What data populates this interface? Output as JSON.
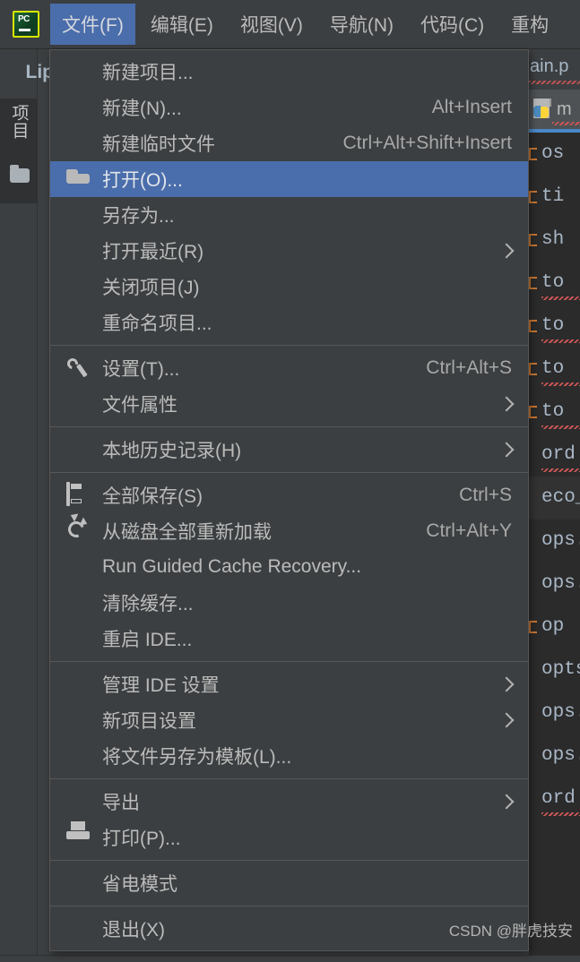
{
  "app": {
    "logo_text": "PC",
    "panel_label": "Lip"
  },
  "menubar": {
    "items": [
      {
        "label": "文件(F)",
        "mnemonic": "F",
        "active": true
      },
      {
        "label": "编辑(E)",
        "mnemonic": "E",
        "active": false
      },
      {
        "label": "视图(V)",
        "mnemonic": "V",
        "active": false
      },
      {
        "label": "导航(N)",
        "mnemonic": "N",
        "active": false
      },
      {
        "label": "代码(C)",
        "mnemonic": "C",
        "active": false
      },
      {
        "label": "重构",
        "mnemonic": "",
        "active": false
      }
    ]
  },
  "sidebar": {
    "project_tab_label": "项目",
    "folder_icon": "folder-icon"
  },
  "file_menu": {
    "groups": [
      {
        "items": [
          {
            "label": "新建项目...",
            "accel": "",
            "icon": "",
            "arrow": false,
            "selected": false
          },
          {
            "label": "新建(N)...",
            "accel": "Alt+Insert",
            "icon": "",
            "arrow": false,
            "selected": false
          },
          {
            "label": "新建临时文件",
            "accel": "Ctrl+Alt+Shift+Insert",
            "icon": "",
            "arrow": false,
            "selected": false
          },
          {
            "label": "打开(O)...",
            "accel": "",
            "icon": "folder-open-icon",
            "arrow": false,
            "selected": true
          },
          {
            "label": "另存为...",
            "accel": "",
            "icon": "",
            "arrow": false,
            "selected": false
          },
          {
            "label": "打开最近(R)",
            "accel": "",
            "icon": "",
            "arrow": true,
            "selected": false
          },
          {
            "label": "关闭项目(J)",
            "accel": "",
            "icon": "",
            "arrow": false,
            "selected": false
          },
          {
            "label": "重命名项目...",
            "accel": "",
            "icon": "",
            "arrow": false,
            "selected": false
          }
        ]
      },
      {
        "items": [
          {
            "label": "设置(T)...",
            "accel": "Ctrl+Alt+S",
            "icon": "wrench-icon",
            "arrow": false,
            "selected": false
          },
          {
            "label": "文件属性",
            "accel": "",
            "icon": "",
            "arrow": true,
            "selected": false
          }
        ]
      },
      {
        "items": [
          {
            "label": "本地历史记录(H)",
            "accel": "",
            "icon": "",
            "arrow": true,
            "selected": false
          }
        ]
      },
      {
        "items": [
          {
            "label": "全部保存(S)",
            "accel": "Ctrl+S",
            "icon": "save-icon",
            "arrow": false,
            "selected": false
          },
          {
            "label": "从磁盘全部重新加载",
            "accel": "Ctrl+Alt+Y",
            "icon": "reload-icon",
            "arrow": false,
            "selected": false
          },
          {
            "label": "Run Guided Cache Recovery...",
            "accel": "",
            "icon": "",
            "arrow": false,
            "selected": false
          },
          {
            "label": "清除缓存...",
            "accel": "",
            "icon": "",
            "arrow": false,
            "selected": false
          },
          {
            "label": "重启 IDE...",
            "accel": "",
            "icon": "",
            "arrow": false,
            "selected": false
          }
        ]
      },
      {
        "items": [
          {
            "label": "管理 IDE 设置",
            "accel": "",
            "icon": "",
            "arrow": true,
            "selected": false
          },
          {
            "label": "新项目设置",
            "accel": "",
            "icon": "",
            "arrow": true,
            "selected": false
          },
          {
            "label": "将文件另存为模板(L)...",
            "accel": "",
            "icon": "",
            "arrow": false,
            "selected": false
          }
        ]
      },
      {
        "items": [
          {
            "label": "导出",
            "accel": "",
            "icon": "",
            "arrow": true,
            "selected": false
          },
          {
            "label": "打印(P)...",
            "accel": "",
            "icon": "print-icon",
            "arrow": false,
            "selected": false
          }
        ]
      },
      {
        "items": [
          {
            "label": "省电模式",
            "accel": "",
            "icon": "",
            "arrow": false,
            "selected": false
          }
        ]
      },
      {
        "items": [
          {
            "label": "退出(X)",
            "accel": "",
            "icon": "",
            "arrow": false,
            "selected": false
          }
        ]
      }
    ]
  },
  "editor": {
    "tab_text": "ain.p",
    "file_tab_name": "m",
    "file_icon": "python-file-icon",
    "code_lines": [
      {
        "text": "os",
        "fold": true,
        "error": false,
        "highlight": false
      },
      {
        "text": "ti",
        "fold": true,
        "error": false,
        "highlight": false
      },
      {
        "text": "sh",
        "fold": true,
        "error": false,
        "highlight": false
      },
      {
        "text": "to",
        "fold": true,
        "error": true,
        "highlight": false
      },
      {
        "text": "to",
        "fold": true,
        "error": true,
        "highlight": false
      },
      {
        "text": "to",
        "fold": true,
        "error": true,
        "highlight": false
      },
      {
        "text": "to",
        "fold": true,
        "error": true,
        "highlight": false
      },
      {
        "text": "ord",
        "fold": false,
        "error": true,
        "highlight": false
      },
      {
        "text": "eco_",
        "fold": false,
        "error": false,
        "highlight": true
      },
      {
        "text": "ops.",
        "fold": false,
        "error": false,
        "highlight": false
      },
      {
        "text": "ops.",
        "fold": false,
        "error": false,
        "highlight": false
      },
      {
        "text": "op",
        "fold": true,
        "error": false,
        "highlight": false
      },
      {
        "text": "opts",
        "fold": false,
        "error": false,
        "highlight": false
      },
      {
        "text": "ops.",
        "fold": false,
        "error": false,
        "highlight": false
      },
      {
        "text": "ops.",
        "fold": false,
        "error": false,
        "highlight": false
      },
      {
        "text": "ord",
        "fold": false,
        "error": true,
        "highlight": false
      }
    ]
  },
  "watermark": {
    "text": "CSDN @胖虎技安"
  },
  "colors": {
    "menu_bg": "#3c3f41",
    "menu_highlight": "#4a6dab",
    "editor_bg": "#2b2b2b",
    "text": "#bbbbbb",
    "accent_orange": "#cc7832",
    "error_red": "#cc5555",
    "tab_underline": "#4a88c7"
  }
}
